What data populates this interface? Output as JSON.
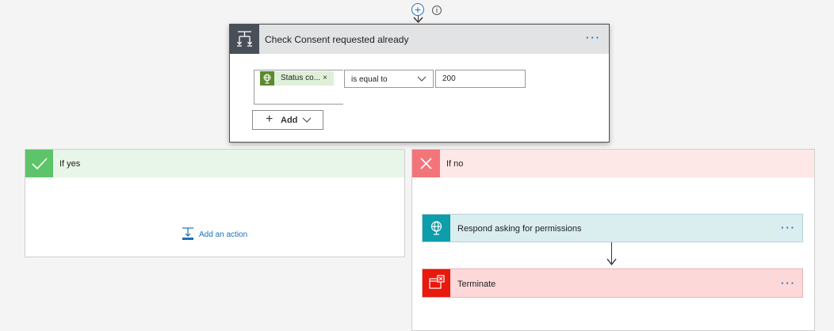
{
  "connector": {
    "insert_glyph": "+",
    "info_glyph": "i"
  },
  "condition_card": {
    "title": "Check Consent requested already",
    "more_glyph": "···",
    "token_label": "Status co...",
    "token_remove_glyph": "×",
    "operator": "is equal to",
    "value": "200",
    "add_label": "Add",
    "add_plus_glyph": "+"
  },
  "branches": {
    "yes": {
      "title": "If yes",
      "add_action_label": "Add an action"
    },
    "no": {
      "title": "If no",
      "actions": [
        {
          "title": "Respond asking for permissions",
          "more_glyph": "···"
        },
        {
          "title": "Terminate",
          "more_glyph": "···"
        }
      ]
    }
  },
  "icons": {
    "condition": "condition-icon",
    "token": "globe-icon",
    "yes": "checkmark-icon",
    "no": "close-icon",
    "respond": "globe-icon",
    "terminate": "terminate-icon",
    "add_action": "add-action-icon"
  },
  "colors": {
    "accent": "#1f6fb8",
    "condition_header": "#e1e3e4",
    "condition_icon_bg": "#484f58",
    "yes_header": "#e8f5e9",
    "yes_icon_bg": "#5ec46a",
    "no_header": "#fde7e7",
    "no_icon_bg": "#f2757a",
    "respond_bg": "#daeef0",
    "respond_icon_bg": "#0e9dab",
    "terminate_bg": "#fdd8d8",
    "terminate_icon_bg": "#e8190d"
  }
}
